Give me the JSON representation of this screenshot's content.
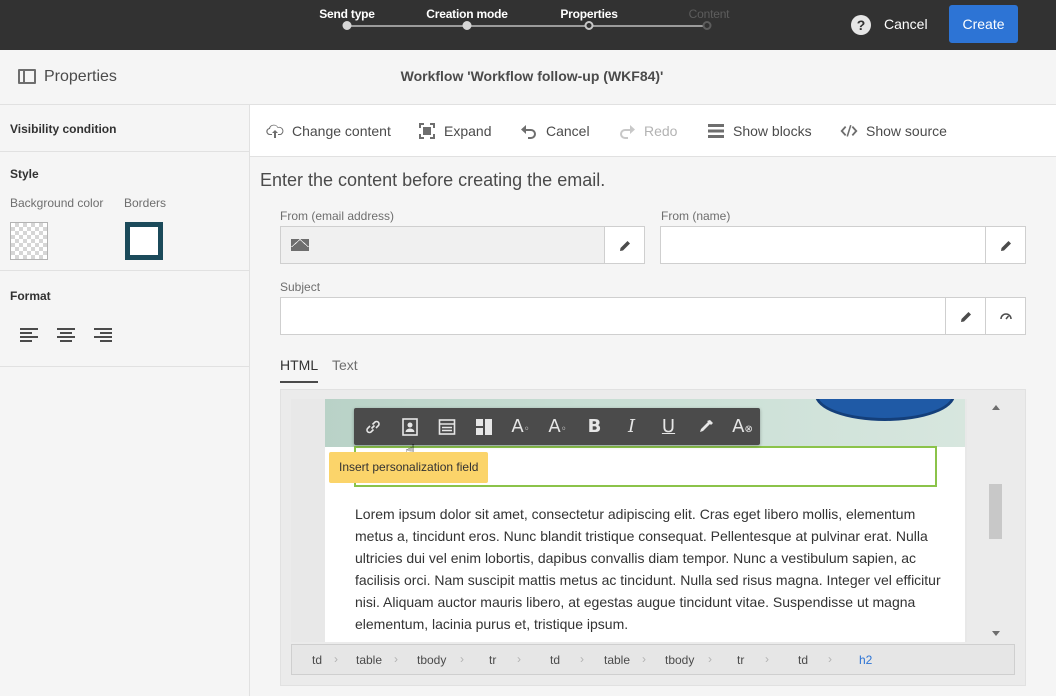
{
  "topbar": {
    "steps": [
      {
        "label": "Send type",
        "state": "done"
      },
      {
        "label": "Creation mode",
        "state": "done"
      },
      {
        "label": "Properties",
        "state": "current"
      },
      {
        "label": "Content",
        "state": "pending"
      }
    ],
    "help_label": "?",
    "cancel_label": "Cancel",
    "create_label": "Create",
    "accent": "#2d74d5"
  },
  "titlebar": {
    "panel_title": "Properties",
    "workflow_title": "Workflow 'Workflow follow-up (WKF84)'"
  },
  "left_panel": {
    "visibility_condition": "Visibility condition",
    "style_heading": "Style",
    "background_color_label": "Background color",
    "borders_label": "Borders",
    "border_color": "#1b4a5a",
    "format_heading": "Format"
  },
  "toolbar": {
    "change_content": "Change content",
    "expand": "Expand",
    "cancel": "Cancel",
    "redo": "Redo",
    "show_blocks": "Show blocks",
    "show_source": "Show source"
  },
  "content": {
    "intro": "Enter the content before creating the email.",
    "from_email_label": "From (email address)",
    "from_email_value": "",
    "from_name_label": "From (name)",
    "from_name_value": "",
    "subject_label": "Subject",
    "subject_value": ""
  },
  "tabs": [
    {
      "label": "HTML",
      "active": true
    },
    {
      "label": "Text",
      "active": false
    }
  ],
  "editor": {
    "tooltip": "Insert personalization field",
    "body_text": "Lorem ipsum dolor sit amet, consectetur adipiscing elit. Cras eget libero mollis, elementum metus a, tincidunt eros. Nunc blandit tristique consequat. Pellentesque at pulvinar erat. Nulla ultricies dui vel enim lobortis, dapibus convallis diam tempor. Nunc a vestibulum sapien, ac facilisis orci. Nam suscipit mattis metus ac tincidunt. Nulla sed risus magna. Integer vel efficitur nisi. Aliquam auctor mauris libero, at egestas augue tincidunt vitae. Suspendisse ut magna elementum, lacinia purus et, tristique ipsum.",
    "format_buttons": [
      "link-icon",
      "personalization-field-icon",
      "content-block-icon",
      "dynamic-content-icon",
      "text-color-icon",
      "text-background-icon",
      "bold-icon",
      "italic-icon",
      "underline-icon",
      "eyedropper-icon",
      "clear-format-icon"
    ],
    "breadcrumb": [
      "td",
      "table",
      "tbody",
      "tr",
      "td",
      "table",
      "tbody",
      "tr",
      "td",
      "h2"
    ]
  }
}
